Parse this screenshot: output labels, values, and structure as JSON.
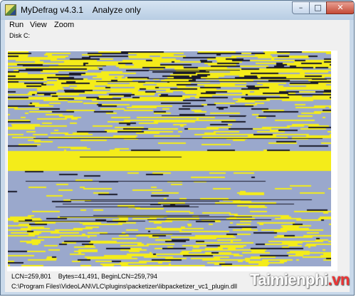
{
  "window": {
    "title": "MyDefrag v4.3.1    Analyze only",
    "min_glyph": "–",
    "max_glyph": "□",
    "close_glyph": "✕"
  },
  "menu": [
    {
      "label": "Run"
    },
    {
      "label": "View"
    },
    {
      "label": "Zoom"
    }
  ],
  "disk": {
    "label": "Disk C:"
  },
  "status": {
    "lcn_line": "LCN=259,801    Bytes=41,491, BeginLCN=259,794",
    "file_path": "C:\\Program Files\\VideoLAN\\VLC\\plugins\\packetizer\\libpacketizer_vc1_plugin.dll"
  },
  "watermark": {
    "text": "Taimienphi",
    "suffix": ".vn"
  },
  "colors": {
    "free": "#9aa8cc",
    "used": "#f4ec1a",
    "busy": "#1a1a2a",
    "frame": "#ffffff"
  }
}
